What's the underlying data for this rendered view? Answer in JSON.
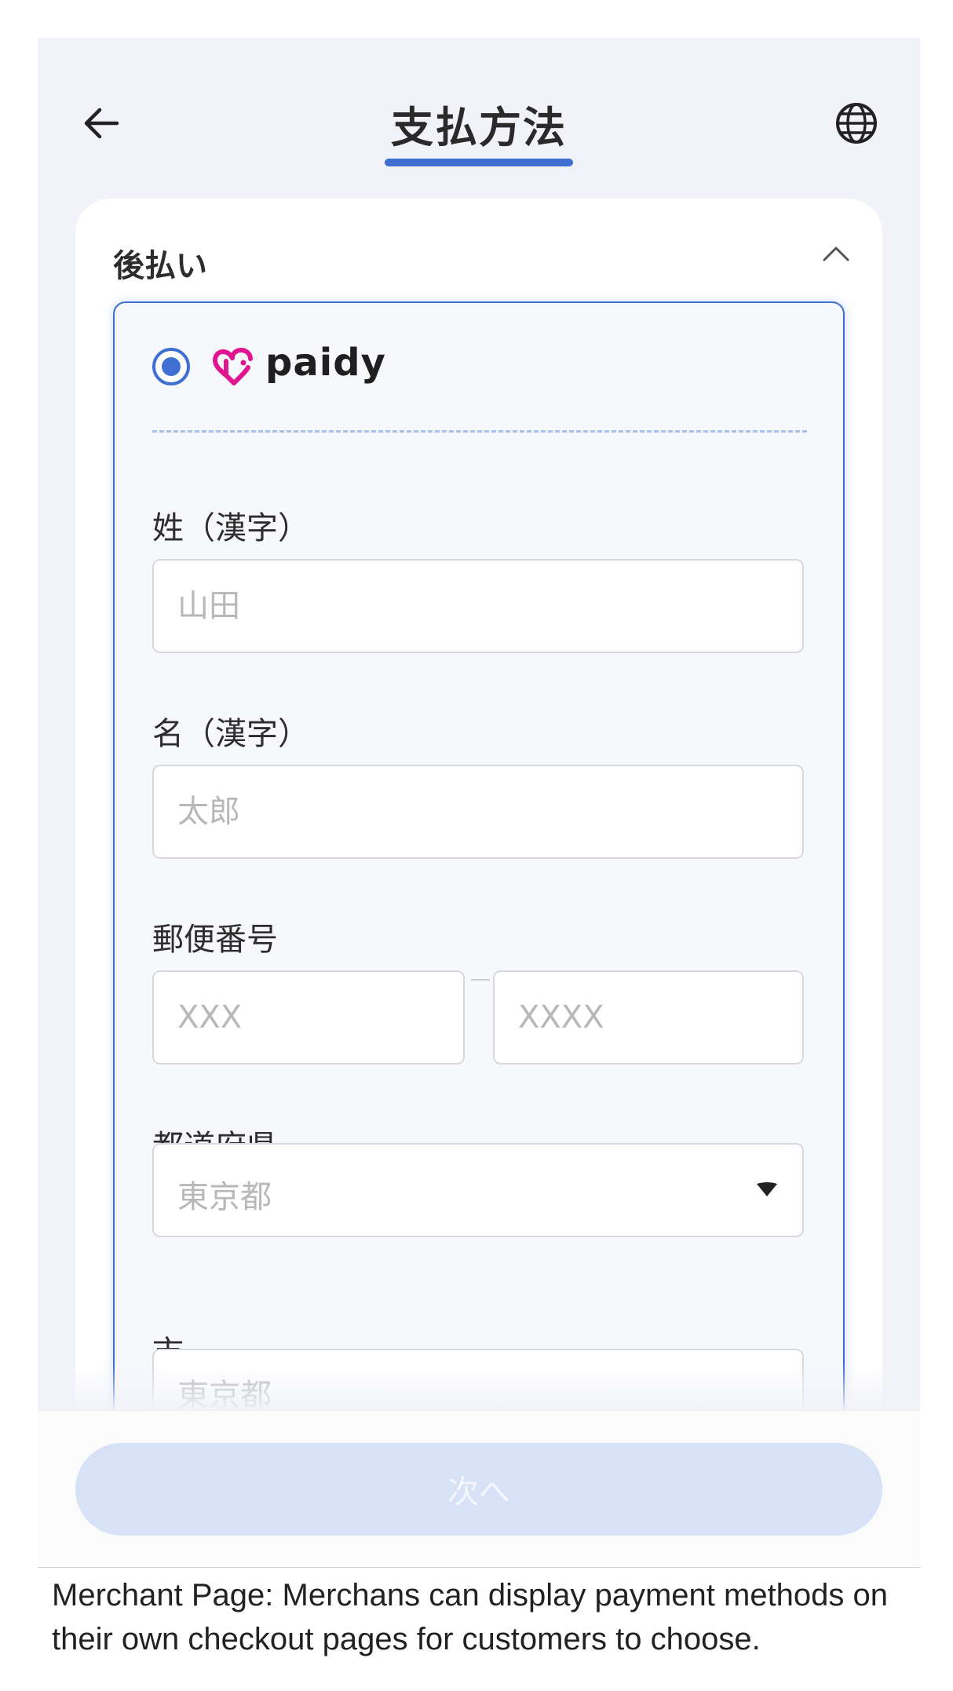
{
  "header": {
    "title": "支払方法",
    "back_icon": "arrow-left-icon",
    "language_icon": "globe-icon"
  },
  "section": {
    "title": "後払い",
    "collapse_icon": "chevron-up-icon"
  },
  "payment_option": {
    "brand": "paidy",
    "brand_color": "#e0158f",
    "accent_color": "#3f6fd1",
    "selected": true
  },
  "form": {
    "last_name": {
      "label": "姓（漢字）",
      "placeholder": "山田",
      "value": ""
    },
    "first_name": {
      "label": "名（漢字）",
      "placeholder": "太郎",
      "value": ""
    },
    "postal_code": {
      "label": "郵便番号",
      "part1_placeholder": "XXX",
      "separator": "–",
      "part2_placeholder": "XXXX"
    },
    "prefecture": {
      "label": "都道府県",
      "selected_value": "東京都"
    },
    "city": {
      "label": "市",
      "placeholder": "東京都",
      "value": ""
    }
  },
  "footer": {
    "next_label": "次へ"
  },
  "caption": "Merchant Page: Merchans can display payment methods on their own checkout pages for customers to choose."
}
